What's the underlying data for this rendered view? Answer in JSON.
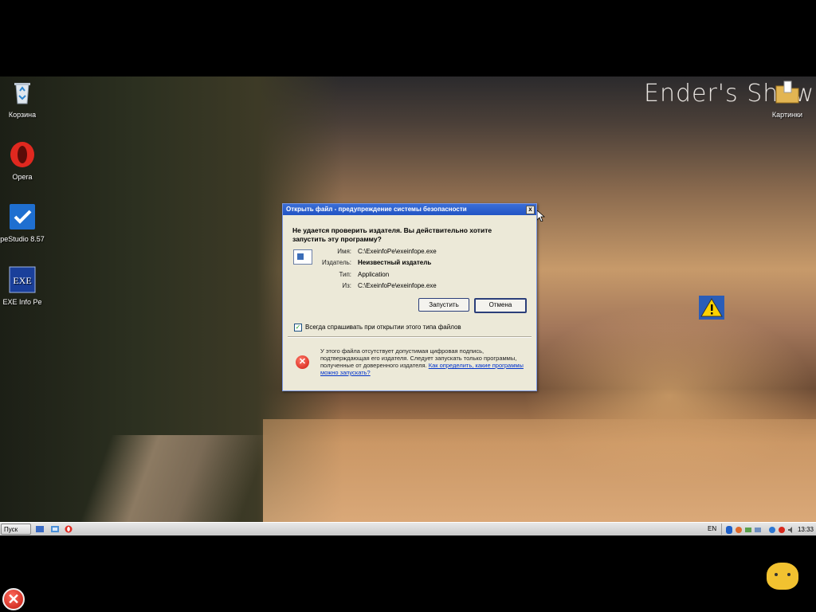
{
  "desktop": {
    "watermark": "Ender's Show",
    "icons": [
      {
        "label": "Корзина",
        "icon": "recycle-bin-icon"
      },
      {
        "label": "Opera",
        "icon": "opera-icon"
      },
      {
        "label": "peStudio 8.57",
        "icon": "pestudio-icon"
      },
      {
        "label": "EXE Info Pe",
        "icon": "exeinfo-icon"
      },
      {
        "label": "Картинки",
        "icon": "folder-icon"
      }
    ]
  },
  "dialog": {
    "title": "Открыть файл - предупреждение системы безопасности",
    "close": "x",
    "question": "Не удается проверить издателя.  Вы действительно хотите запустить эту программу?",
    "fields": [
      {
        "key": "Имя:",
        "value": "C:\\ExeinfoPe\\exeinfope.exe",
        "bold": false
      },
      {
        "key": "Издатель:",
        "value": "Неизвестный издатель",
        "bold": true
      },
      {
        "key": "Тип:",
        "value": "Application",
        "bold": false
      },
      {
        "key": "Из:",
        "value": "C:\\ExeinfoPe\\exeinfope.exe",
        "bold": false
      }
    ],
    "run_button": "Запустить",
    "cancel_button": "Отмена",
    "checkbox_label": "Всегда спрашивать при открытии этого типа файлов",
    "checkbox_checked": true,
    "warning_text": "У этого файла отсутствует допустимая цифровая подпись, подтверждающая его издателя.  Следует запускать только программы, полученные от доверенного издателя.",
    "warning_link": "Как определить, какие программы можно запускать?"
  },
  "taskbar": {
    "start_label": "Пуск",
    "language": "EN",
    "clock": "13:33"
  },
  "colors": {
    "titlebar": "#2254c4",
    "dialog_bg": "#ece9d8",
    "link": "#0033cc"
  }
}
